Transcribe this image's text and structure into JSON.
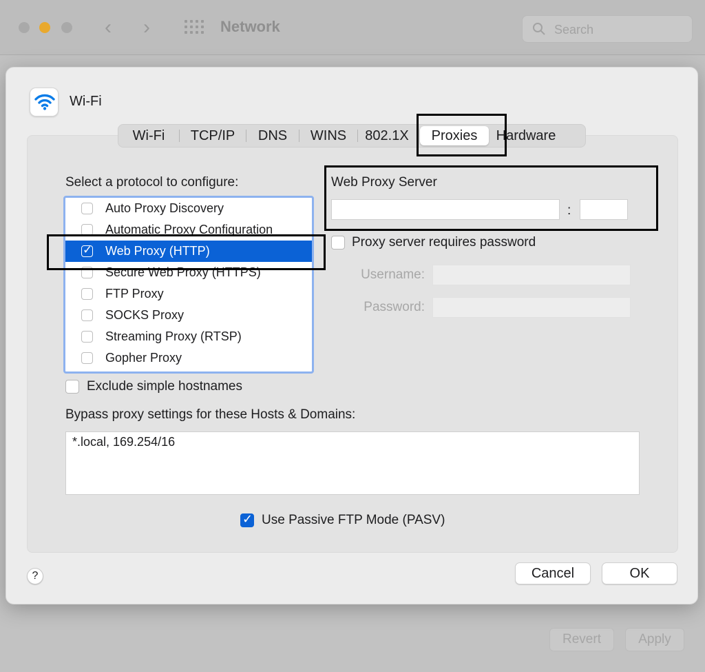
{
  "window": {
    "title": "Network",
    "search_placeholder": "Search",
    "revert_label": "Revert",
    "apply_label": "Apply"
  },
  "sheet": {
    "title": "Wi-Fi",
    "icon": "wifi-icon",
    "tabs": [
      {
        "label": "Wi-Fi"
      },
      {
        "label": "TCP/IP"
      },
      {
        "label": "DNS"
      },
      {
        "label": "WINS"
      },
      {
        "label": "802.1X"
      },
      {
        "label": "Proxies"
      },
      {
        "label": "Hardware"
      }
    ],
    "selected_tab": "Proxies",
    "protocol_label": "Select a protocol to configure:",
    "protocols": [
      {
        "label": "Auto Proxy Discovery",
        "checked": false
      },
      {
        "label": "Automatic Proxy Configuration",
        "checked": false
      },
      {
        "label": "Web Proxy (HTTP)",
        "checked": true
      },
      {
        "label": "Secure Web Proxy (HTTPS)",
        "checked": false
      },
      {
        "label": "FTP Proxy",
        "checked": false
      },
      {
        "label": "SOCKS Proxy",
        "checked": false
      },
      {
        "label": "Streaming Proxy (RTSP)",
        "checked": false
      },
      {
        "label": "Gopher Proxy",
        "checked": false
      }
    ],
    "server": {
      "title": "Web Proxy Server",
      "host_value": "",
      "colon": ":",
      "port_value": "",
      "requires_password_label": "Proxy server requires password",
      "requires_password": false,
      "username_label": "Username:",
      "password_label": "Password:"
    },
    "exclude_label": "Exclude simple hostnames",
    "exclude_checked": false,
    "bypass_label": "Bypass proxy settings for these Hosts & Domains:",
    "bypass_value": "*.local, 169.254/16",
    "passive_ftp_label": "Use Passive FTP Mode (PASV)",
    "passive_ftp_checked": true,
    "help_label": "?",
    "cancel_label": "Cancel",
    "ok_label": "OK"
  }
}
